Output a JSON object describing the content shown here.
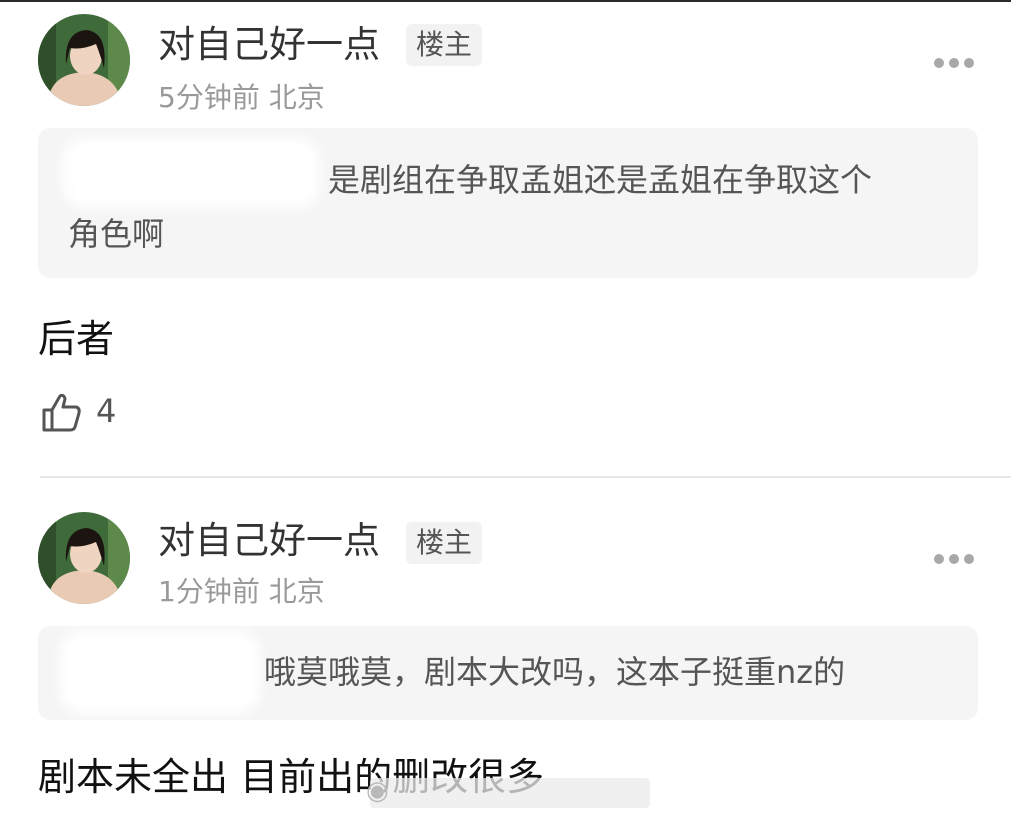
{
  "posts": [
    {
      "author": "对自己好一点",
      "badge": "楼主",
      "time": "5分钟前",
      "location": "北京",
      "quote_line1": "是剧组在争取孟姐还是孟姐在争取这个",
      "quote_line2": "角色啊",
      "reply": "后者",
      "likes": "4"
    },
    {
      "author": "对自己好一点",
      "badge": "楼主",
      "time": "1分钟前",
      "location": "北京",
      "quote_line1": "哦莫哦莫，剧本大改吗，这本子挺重nz的",
      "reply": "剧本未全出 目前出的删改很多"
    }
  ],
  "icons": {
    "more": "more-dots-icon",
    "like": "thumbs-up-icon",
    "watermark": "weibo-logo-icon"
  },
  "colors": {
    "quote_bg": "#f5f5f5",
    "badge_bg": "#f2f2f2",
    "meta_text": "#9a9a9a"
  }
}
